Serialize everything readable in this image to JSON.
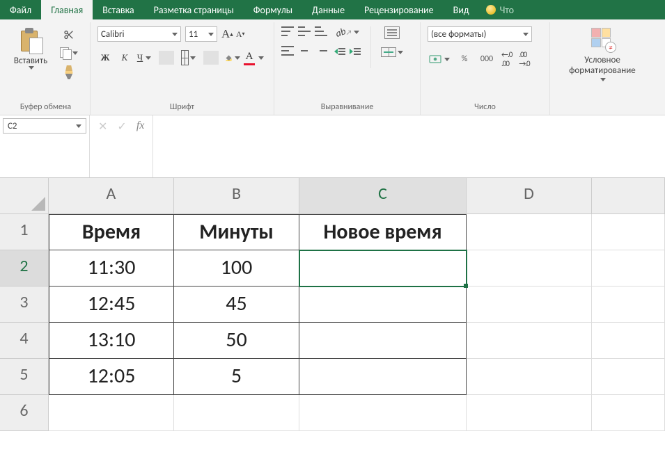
{
  "tabs": {
    "file": "Файл",
    "home": "Главная",
    "insert": "Вставка",
    "pagelayout": "Разметка страницы",
    "formulas": "Формулы",
    "data": "Данные",
    "review": "Рецензирование",
    "view": "Вид",
    "tellme": "Что"
  },
  "ribbon": {
    "clipboard": {
      "paste": "Вставить",
      "label": "Буфер обмена"
    },
    "font": {
      "name": "Calibri",
      "size": "11",
      "bold": "Ж",
      "italic": "К",
      "underline": "Ч",
      "label": "Шрифт"
    },
    "alignment": {
      "label": "Выравнивание"
    },
    "number": {
      "format": "(все форматы)",
      "pct": "%",
      "thou": "000",
      "label": "Число"
    },
    "condfmt": {
      "label": "Условное\nформатирование"
    }
  },
  "namebox": "C2",
  "fx": "fx",
  "columns": [
    "A",
    "B",
    "C",
    "D"
  ],
  "rows": [
    "1",
    "2",
    "3",
    "4",
    "5",
    "6"
  ],
  "sheet": {
    "headers": [
      "Время",
      "Минуты",
      "Новое время"
    ],
    "data": [
      [
        "11:30",
        "100",
        ""
      ],
      [
        "12:45",
        "45",
        ""
      ],
      [
        "13:10",
        "50",
        ""
      ],
      [
        "12:05",
        "5",
        ""
      ]
    ]
  }
}
